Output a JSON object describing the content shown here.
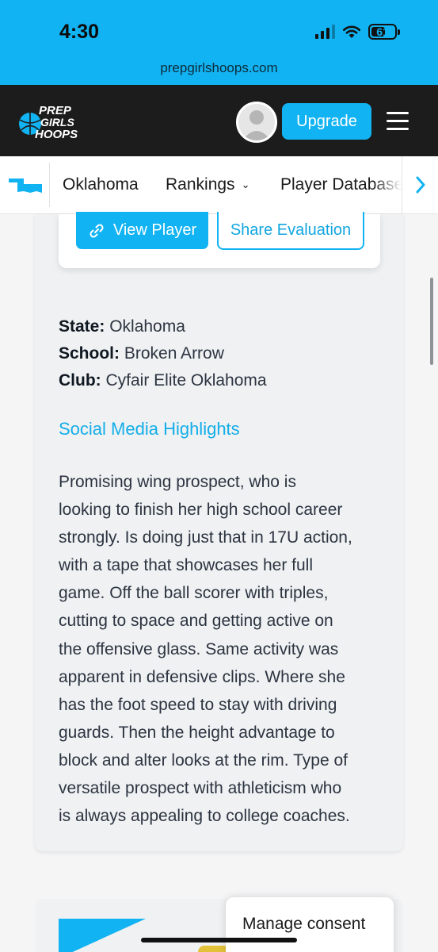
{
  "status_bar": {
    "time": "4:30",
    "battery": "61",
    "battery_level": 0.61
  },
  "browser": {
    "url": "prepgirlshoops.com"
  },
  "header": {
    "logo_lines": [
      "PREP",
      "GIRLS",
      "HOOPS"
    ],
    "upgrade_label": "Upgrade"
  },
  "nav": {
    "state_icon": "oklahoma-state-icon",
    "items": [
      "Oklahoma",
      "Rankings",
      "Player Database"
    ],
    "rankings_chevron": "⌄",
    "scroll_arrow": "chevron-right-icon"
  },
  "actions": {
    "view_player": "View Player",
    "share_evaluation": "Share Evaluation"
  },
  "profile": {
    "state_label": "State:",
    "state_value": "Oklahoma",
    "school_label": "School:",
    "school_value": "Broken Arrow",
    "club_label": "Club:",
    "club_value": "Cyfair Elite Oklahoma"
  },
  "social_link": "Social Media Highlights",
  "evaluation_lines": [
    "Promising wing prospect, who is",
    "looking to finish her high school career",
    "strongly. Is doing just that in 17U action,",
    "with a tape that showcases her full",
    "game. Off the ball scorer with triples,",
    "cutting to space and getting active on",
    "the offensive glass. Same activity was",
    "apparent in defensive clips. Where she",
    "has the foot speed to stay with driving",
    "guards. Then the height advantage to",
    "block and alter looks at the rim. Type of",
    "versatile prospect with athleticism who",
    "is always appealing to college coaches."
  ],
  "consent": {
    "label": "Manage consent"
  },
  "colors": {
    "accent": "#12b3f2",
    "header_bg": "#1c1c1c",
    "text": "#2c3440"
  }
}
